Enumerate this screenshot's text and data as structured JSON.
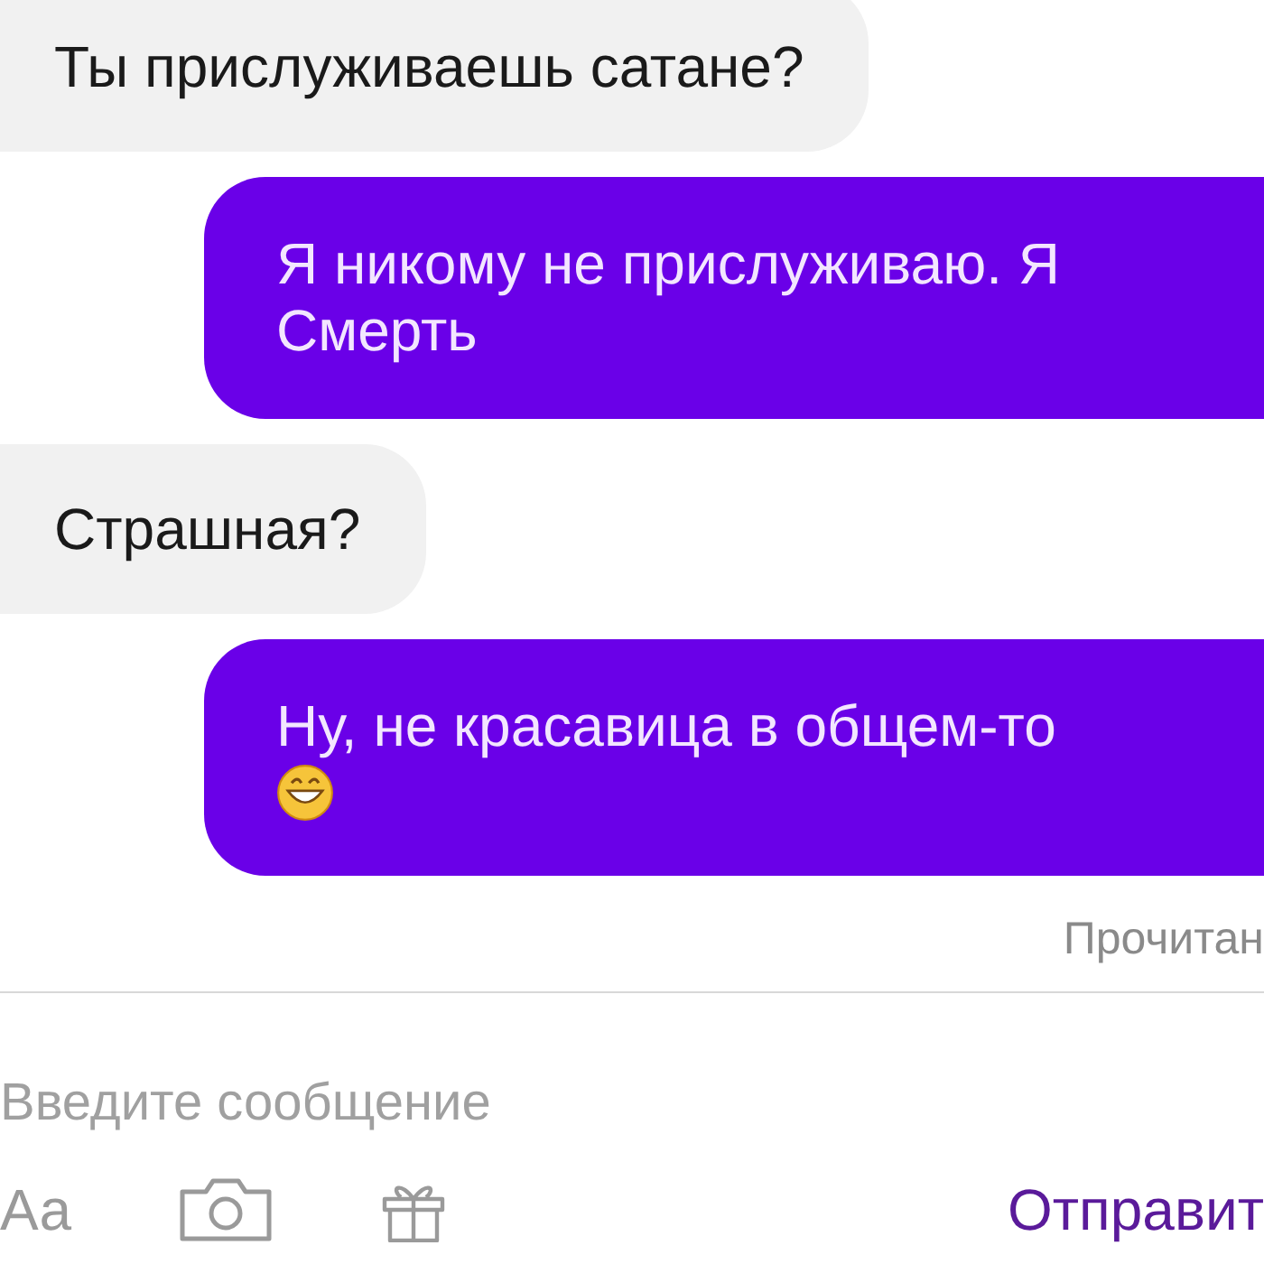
{
  "messages": [
    {
      "kind": "incoming",
      "text": "Ты прислуживаешь сатане?"
    },
    {
      "kind": "outgoing",
      "text": "Я никому не прислуживаю. Я Смерть",
      "has_emoji": false
    },
    {
      "kind": "incoming",
      "text": "Страшная?"
    },
    {
      "kind": "outgoing",
      "text": "Ну, не красавица в общем-то",
      "has_emoji": true
    }
  ],
  "read_status": "Прочитан",
  "composer": {
    "placeholder": "Введите сообщение",
    "format_label": "Аа",
    "send_label": "Отправит"
  }
}
